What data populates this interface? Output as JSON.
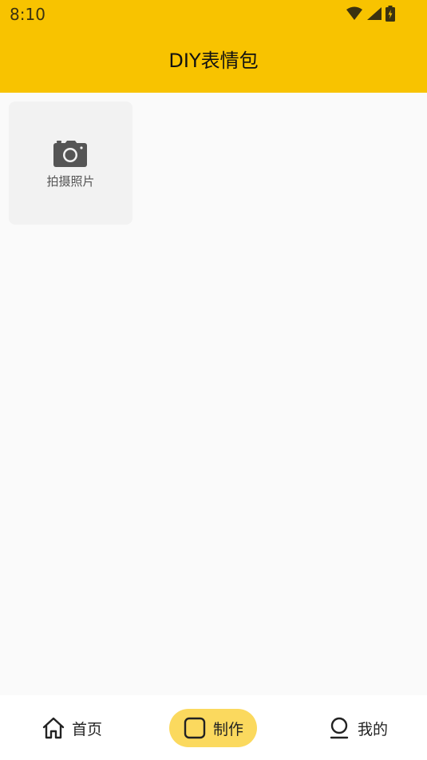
{
  "status_bar": {
    "time": "8:10",
    "icons": [
      "wifi-icon",
      "signal-icon",
      "battery-charging-icon"
    ]
  },
  "app_bar": {
    "title": "DIY表情包"
  },
  "main": {
    "photo_tile": {
      "icon": "camera-icon",
      "label": "拍摄照片"
    }
  },
  "bottom_nav": {
    "items": [
      {
        "label": "首页",
        "icon": "home-icon",
        "active": false
      },
      {
        "label": "制作",
        "icon": "square-icon",
        "active": true
      },
      {
        "label": "我的",
        "icon": "person-icon",
        "active": false
      }
    ]
  },
  "colors": {
    "header": "#f8c300",
    "active_tab": "#fbd95e",
    "background": "#fafafa",
    "tile": "#f2f2f2"
  }
}
